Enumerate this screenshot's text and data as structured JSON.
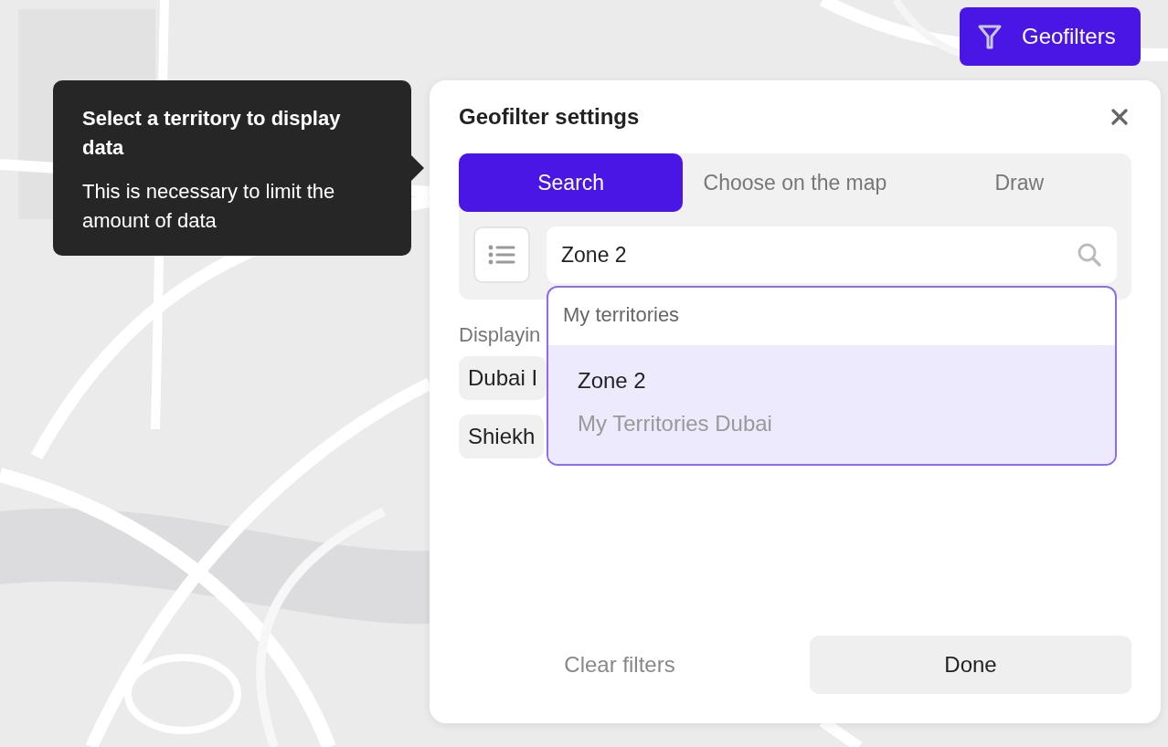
{
  "geofilters_button": {
    "label": "Geofilters"
  },
  "tooltip": {
    "title": "Select a territory to display data",
    "text": "This is necessary to limit the amount of data"
  },
  "panel": {
    "title": "Geofilter settings",
    "tabs": [
      {
        "label": "Search",
        "selected": true
      },
      {
        "label": "Choose on the map",
        "selected": false
      },
      {
        "label": "Draw",
        "selected": false
      }
    ],
    "search": {
      "value": "Zone 2"
    },
    "dropdown": {
      "header": "My territories",
      "items": [
        {
          "title": "Zone 2",
          "subtitle": "My Territories Dubai",
          "selected": true
        }
      ]
    },
    "displaying_label": "Displayin",
    "chips": [
      {
        "label": "Dubai I"
      },
      {
        "label": "Shiekh"
      }
    ],
    "clear_button": "Clear filters",
    "done_button": "Done"
  }
}
